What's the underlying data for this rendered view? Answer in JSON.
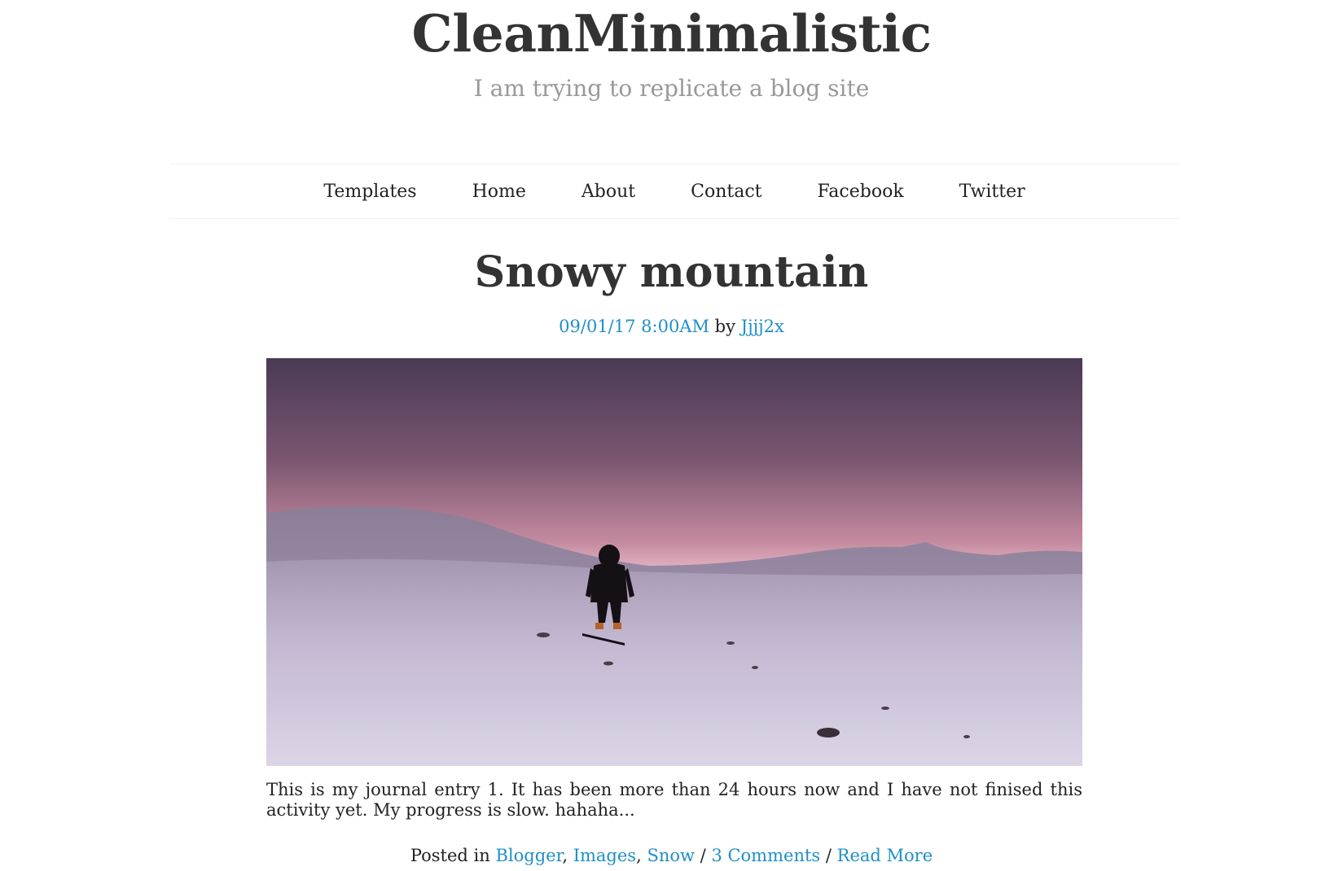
{
  "site": {
    "title": "CleanMinimalistic",
    "tagline": "I am trying to replicate a blog site"
  },
  "nav": {
    "items": [
      {
        "label": "Templates"
      },
      {
        "label": "Home"
      },
      {
        "label": "About"
      },
      {
        "label": "Contact"
      },
      {
        "label": "Facebook"
      },
      {
        "label": "Twitter"
      }
    ]
  },
  "post": {
    "title": "Snowy mountain",
    "date": "09/01/17 8:00AM",
    "by_label": "by",
    "author": "Jjjj2x",
    "image": {
      "sky_top": "#4a3a52",
      "sky_glow": "#f3c8d0",
      "snow": "#d9d2e6"
    },
    "body": "This is my journal entry 1. It has been more than 24 hours now and I have not finised this activity yet. My progress is slow. hahaha...",
    "footer": {
      "posted_in_label": "Posted in",
      "categories": [
        "Blogger",
        "Images",
        "Snow"
      ],
      "comments": "3 Comments",
      "separator": "/",
      "read_more": "Read More"
    }
  },
  "colors": {
    "link": "#1e8fc6",
    "title": "#333333",
    "tagline": "#999999"
  }
}
